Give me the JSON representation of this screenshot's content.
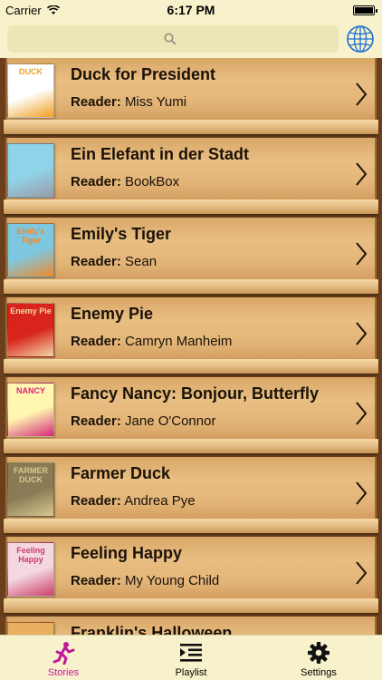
{
  "status_bar": {
    "carrier": "Carrier",
    "time": "6:17 PM"
  },
  "search": {
    "placeholder": ""
  },
  "books": [
    {
      "title": "Duck for President",
      "reader_prefix": "Reader:",
      "reader": "Miss Yumi",
      "cover_text": "DUCK",
      "cover_color": "#ffffff",
      "cover_accent": "#f0a020"
    },
    {
      "title": "Ein Elefant in der Stadt",
      "reader_prefix": "Reader:",
      "reader": "BookBox",
      "cover_text": "",
      "cover_color": "#8fd3e8",
      "cover_accent": "#9a9aa8"
    },
    {
      "title": "Emily's Tiger",
      "reader_prefix": "Reader:",
      "reader": "Sean",
      "cover_text": "Emily's Tiger",
      "cover_color": "#7ec7e0",
      "cover_accent": "#f08a2a"
    },
    {
      "title": "Enemy Pie",
      "reader_prefix": "Reader:",
      "reader": "Camryn Manheim",
      "cover_text": "Enemy Pie",
      "cover_color": "#d8241c",
      "cover_accent": "#f3d8a8"
    },
    {
      "title": "Fancy Nancy: Bonjour, Butterfly",
      "reader_prefix": "Reader:",
      "reader": "Jane O'Connor",
      "cover_text": "NANCY",
      "cover_color": "#fff6b0",
      "cover_accent": "#d4287a"
    },
    {
      "title": "Farmer Duck",
      "reader_prefix": "Reader:",
      "reader": "Andrea Pye",
      "cover_text": "FARMER DUCK",
      "cover_color": "#8a7a55",
      "cover_accent": "#d8c890"
    },
    {
      "title": "Feeling Happy",
      "reader_prefix": "Reader:",
      "reader": "My Young Child",
      "cover_text": "Feeling Happy",
      "cover_color": "#f4d8e0",
      "cover_accent": "#cc3e6a"
    },
    {
      "title": "Franklin's Halloween",
      "reader_prefix": "",
      "reader": "",
      "cover_text": "",
      "cover_color": "#e8b060",
      "cover_accent": "#cf5a2a"
    }
  ],
  "tabs": [
    {
      "label": "Stories",
      "icon": "dancer-icon",
      "active": true
    },
    {
      "label": "Playlist",
      "icon": "playlist-icon",
      "active": false
    },
    {
      "label": "Settings",
      "icon": "gear-icon",
      "active": false
    }
  ],
  "colors": {
    "accent": "#c0189b",
    "bar_background": "#f8f2cc"
  }
}
